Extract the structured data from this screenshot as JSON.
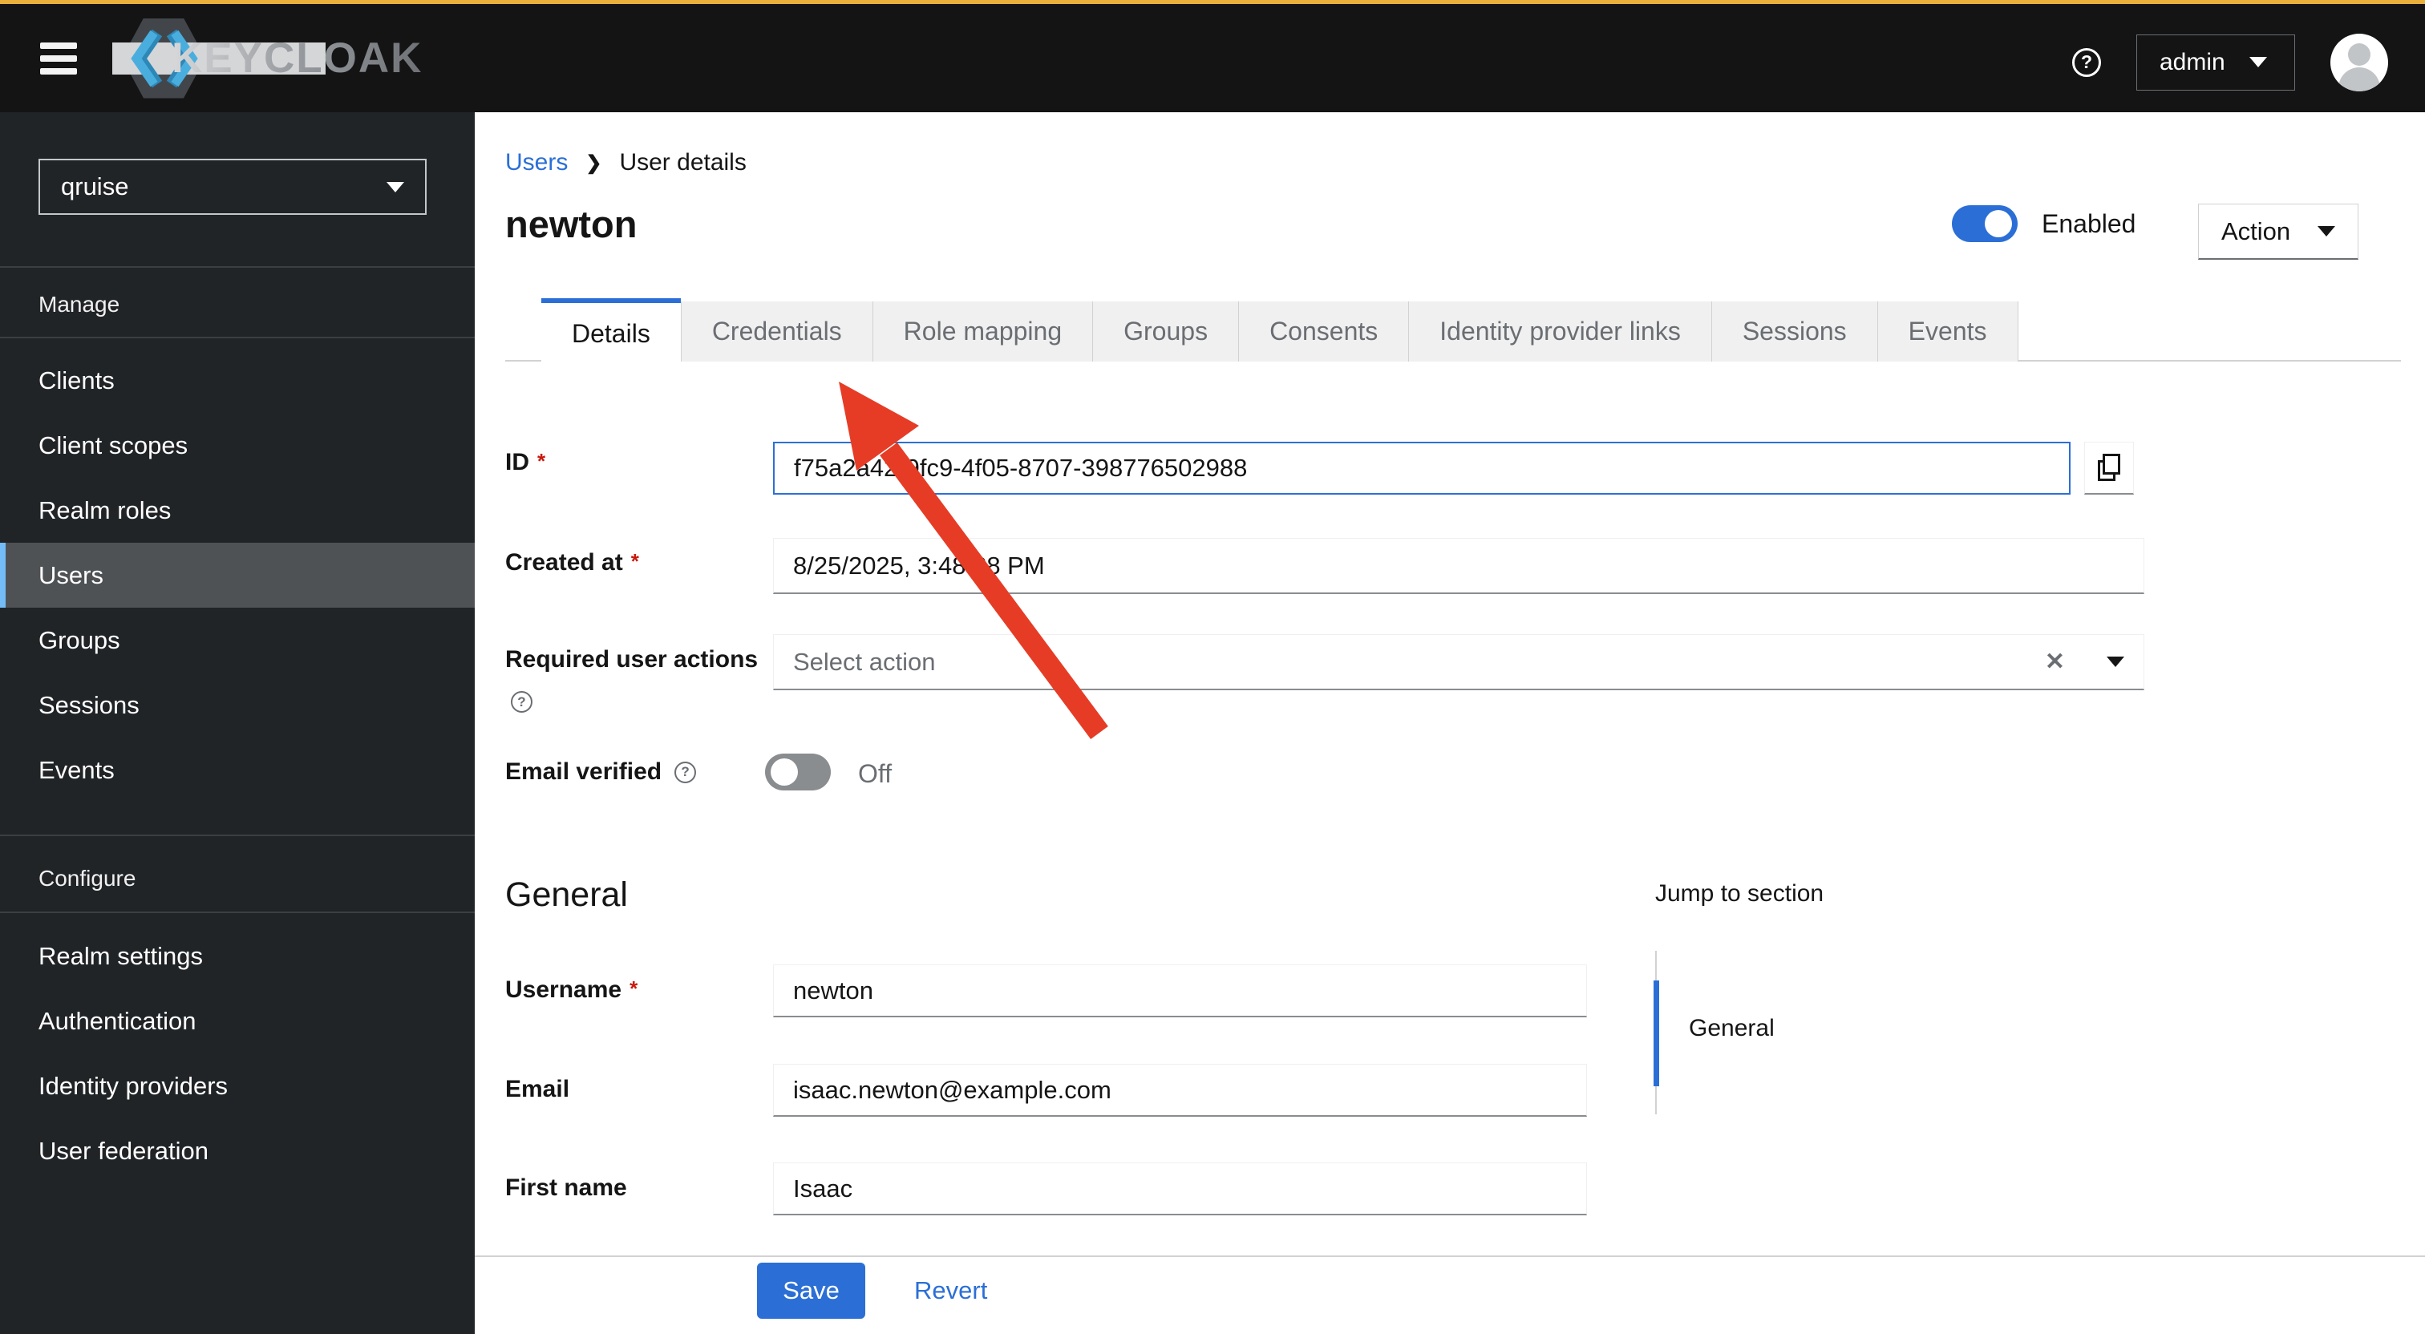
{
  "masthead": {
    "brand": "KEYCLOAK",
    "username": "admin",
    "help_icon": "?"
  },
  "sidebar": {
    "realm": "qruise",
    "selected_item": "Users",
    "sections": [
      {
        "title": "Manage",
        "items": [
          "Clients",
          "Client scopes",
          "Realm roles",
          "Users",
          "Groups",
          "Sessions",
          "Events"
        ]
      },
      {
        "title": "Configure",
        "items": [
          "Realm settings",
          "Authentication",
          "Identity providers",
          "User federation"
        ]
      }
    ]
  },
  "breadcrumb": {
    "items": [
      "Users",
      "User details"
    ],
    "separator": "❯"
  },
  "header": {
    "title": "newton",
    "enabled_label": "Enabled",
    "enabled_state": "on",
    "action_label": "Action"
  },
  "tabs": {
    "active": "Details",
    "items": [
      "Details",
      "Credentials",
      "Role mapping",
      "Groups",
      "Consents",
      "Identity provider links",
      "Sessions",
      "Events"
    ]
  },
  "form": {
    "required_marker": "*",
    "help_glyph": "?",
    "clear_glyph": "✕",
    "id": {
      "label": "ID",
      "value": "f75a2a42-9fc9-4f05-8707-398776502988"
    },
    "created_at": {
      "label": "Created at",
      "value": "8/25/2025, 3:48:28 PM"
    },
    "required_user_actions": {
      "label": "Required user actions",
      "placeholder": "Select action"
    },
    "email_verified": {
      "label": "Email verified",
      "state": "Off"
    }
  },
  "general": {
    "section_title": "General",
    "username": {
      "label": "Username",
      "value": "newton"
    },
    "email": {
      "label": "Email",
      "value": "isaac.newton@example.com"
    },
    "first_name": {
      "label": "First name",
      "value": "Isaac"
    }
  },
  "jump_to_section": {
    "title": "Jump to section",
    "items": [
      "General"
    ],
    "active": "General"
  },
  "footer": {
    "save_label": "Save",
    "revert_label": "Revert"
  },
  "annotation": {
    "type": "arrow",
    "color": "#e63c26"
  },
  "colors": {
    "accent_blue": "#2b6fd6",
    "nav_current_indicator": "#73bcf7",
    "masthead_bg": "#141414",
    "masthead_top_stripe": "#e9b13c",
    "sidebar_bg": "#212427",
    "danger_red": "#c9190b",
    "arrow_red": "#e63c26"
  }
}
